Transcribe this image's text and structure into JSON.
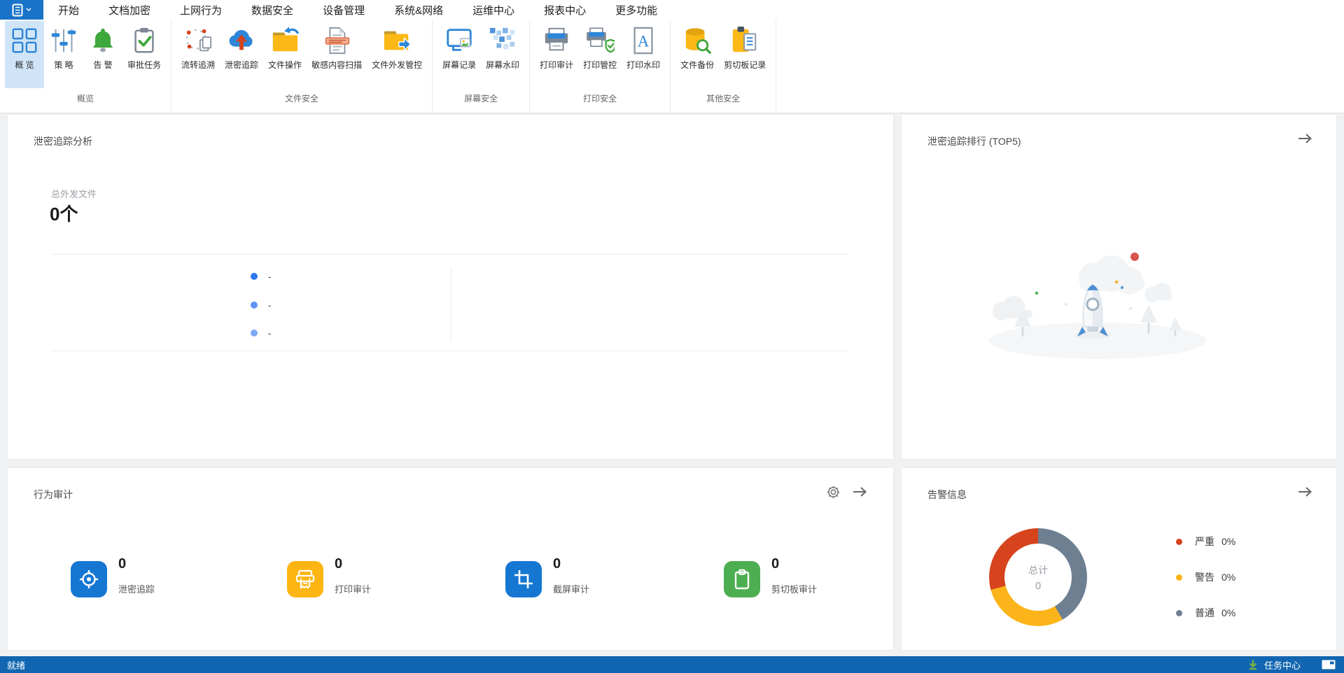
{
  "app": {
    "tabs": [
      "开始",
      "文档加密",
      "上网行为",
      "数据安全",
      "设备管理",
      "系统&网络",
      "运维中心",
      "报表中心",
      "更多功能"
    ],
    "active_tab": "数据安全"
  },
  "ribbon": {
    "selected_item": "概 览",
    "groups": [
      {
        "label": "概览",
        "items": [
          "概 览",
          "策 略",
          "告 警",
          "审批任务"
        ]
      },
      {
        "label": "文件安全",
        "items": [
          "流转追溯",
          "泄密追踪",
          "文件操作",
          "敏感内容扫描",
          "文件外发管控"
        ]
      },
      {
        "label": "屏幕安全",
        "items": [
          "屏幕记录",
          "屏幕水印"
        ]
      },
      {
        "label": "打印安全",
        "items": [
          "打印审计",
          "打印管控",
          "打印水印"
        ]
      },
      {
        "label": "其他安全",
        "items": [
          "文件备份",
          "剪切板记录"
        ]
      }
    ]
  },
  "panels": {
    "leak_analysis": {
      "title": "泄密追踪分析",
      "stat_label": "总外发文件",
      "stat_value": "0个",
      "items": [
        {
          "text": "-",
          "color": "#2c77ee"
        },
        {
          "text": "-",
          "color": "#5e94f2"
        },
        {
          "text": "-",
          "color": "#7fa8f5"
        }
      ]
    },
    "leak_ranking": {
      "title": "泄密追踪排行 (TOP5)"
    },
    "behavior_audit": {
      "title": "行为审计",
      "cards": [
        {
          "value": "0",
          "label": "泄密追踪",
          "color": "#1677d2"
        },
        {
          "value": "0",
          "label": "打印审计",
          "color": "#fcb513"
        },
        {
          "value": "0",
          "label": "截屏审计",
          "color": "#1677d2"
        },
        {
          "value": "0",
          "label": "剪切板审计",
          "color": "#4cae50"
        }
      ]
    },
    "alert_info": {
      "title": "告警信息",
      "center_label": "总计",
      "center_value": "0",
      "legend": [
        {
          "label": "严重",
          "value": "0%",
          "color": "#d6431d"
        },
        {
          "label": "警告",
          "value": "0%",
          "color": "#fbb41a"
        },
        {
          "label": "普通",
          "value": "0%",
          "color": "#6e7f92"
        }
      ]
    }
  },
  "status_bar": {
    "ready": "就绪",
    "task_center": "任务中心"
  },
  "colors": {
    "accent_blue": "#1973c8",
    "statusbar_blue": "#1266b1",
    "ribbon_selected_bg": "#cfe4f7"
  },
  "chart_data": {
    "type": "pie",
    "title": "告警信息",
    "center_label": "总计",
    "center_value": 0,
    "categories": [
      "严重",
      "警告",
      "普通"
    ],
    "values": [
      0,
      0,
      0
    ],
    "unit": "%",
    "legend_position": "right",
    "segments": [
      {
        "label": "普通",
        "color": "#6e7f92",
        "from": 0,
        "to": 150
      },
      {
        "label": "警告",
        "color": "#fbb41a",
        "from": 150,
        "to": 255
      },
      {
        "label": "严重",
        "color": "#d6431d",
        "from": 255,
        "to": 360
      }
    ]
  }
}
